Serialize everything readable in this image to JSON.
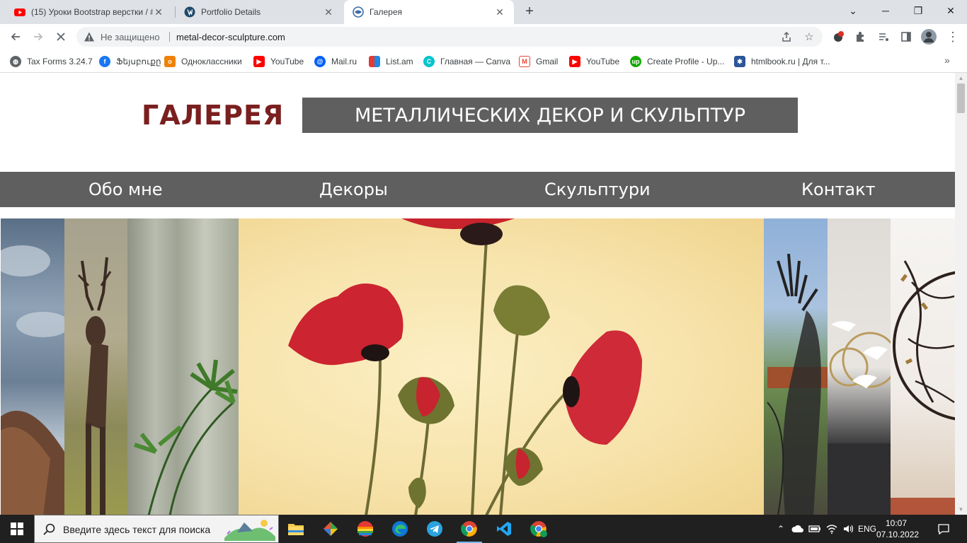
{
  "browser": {
    "tabs": [
      {
        "title": "(15) Уроки Bootstrap верстки / #",
        "icon": "youtube-icon"
      },
      {
        "title": "Portfolio Details",
        "icon": "wordpress-icon"
      },
      {
        "title": "Галерея",
        "icon": "site-icon",
        "active": true
      }
    ],
    "address": {
      "security_status": "Не защищено",
      "url": "metal-decor-sculpture.com"
    },
    "bookmarks": [
      {
        "label": "Tax Forms 3.24.7",
        "icon": "globe-icon",
        "color": "#5f6368"
      },
      {
        "label": "Ֆեյսբուքը",
        "icon": "facebook-icon",
        "color": "#1877f2"
      },
      {
        "label": "Одноклассники",
        "icon": "odnoklassniki-icon",
        "color": "#ee8208"
      },
      {
        "label": "YouTube",
        "icon": "youtube-icon",
        "color": "#ff0000"
      },
      {
        "label": "Mail.ru",
        "icon": "mailru-icon",
        "color": "#005ff9"
      },
      {
        "label": "List.am",
        "icon": "listam-icon",
        "color": "#e53935"
      },
      {
        "label": "Главная — Canva",
        "icon": "canva-icon",
        "color": "#00c4cc"
      },
      {
        "label": "Gmail",
        "icon": "gmail-icon",
        "color": "#ea4335"
      },
      {
        "label": "YouTube",
        "icon": "youtube-icon",
        "color": "#ff0000"
      },
      {
        "label": "Create Profile - Up...",
        "icon": "upwork-icon",
        "color": "#14a800"
      },
      {
        "label": "htmlbook.ru | Для т...",
        "icon": "htmlbook-icon",
        "color": "#2b5797"
      }
    ]
  },
  "site": {
    "title": "ГАЛЕРЕЯ",
    "banner": "МЕТАЛЛИЧЕСКИХ ДЕКОР И СКУЛЬПТУР",
    "nav": [
      "Обо мне",
      "Декоры",
      "Скульптури",
      "Контакт"
    ],
    "title_color": "#7a1f1f",
    "bar_color": "#5f5f5f"
  },
  "taskbar": {
    "search_placeholder": "Введите здесь текст для поиска",
    "language": "ENG",
    "time": "10:07",
    "date": "07.10.2022"
  }
}
